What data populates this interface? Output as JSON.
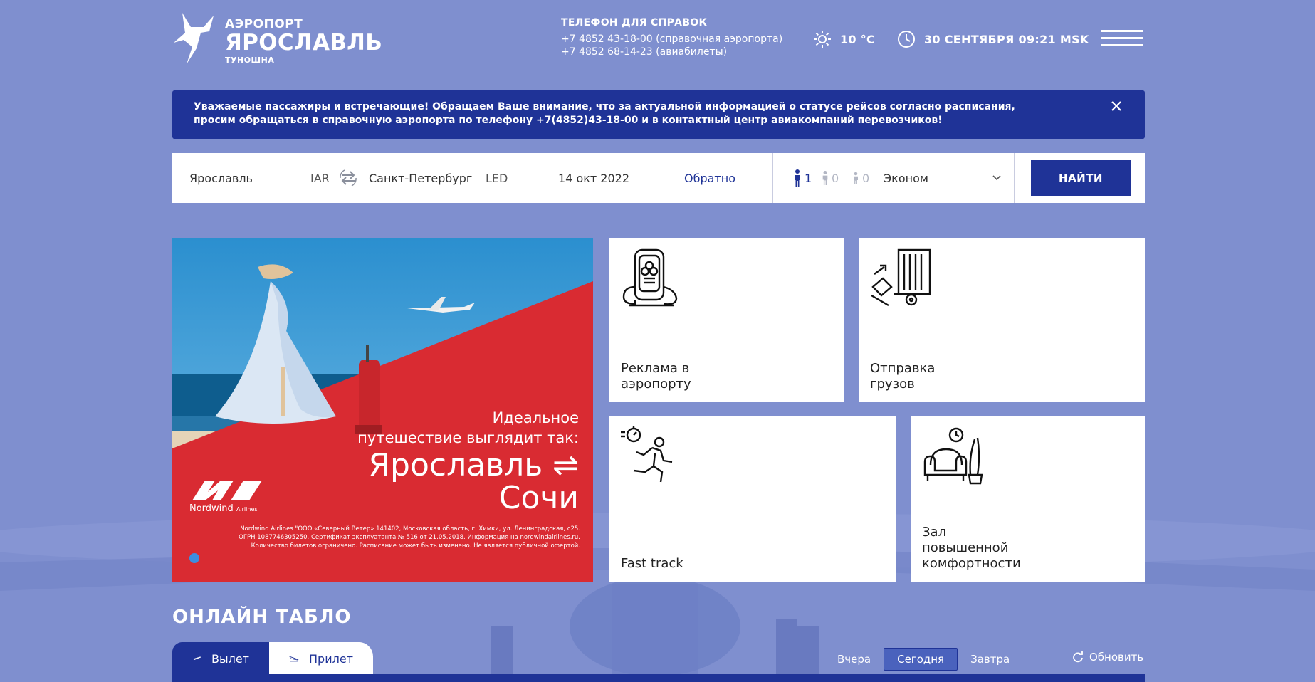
{
  "header": {
    "logo_small": "АЭРОПОРТ",
    "logo_big": "ЯРОСЛАВЛЬ",
    "logo_sub": "ТУНОШНА",
    "phones_title": "ТЕЛЕФОН ДЛЯ СПРАВОК",
    "phone_airport": "+7 4852 43-18-00 (справочная аэропорта)",
    "phone_tickets": "+7 4852 68-14-23 (авиабилеты)",
    "temperature": "10 °C",
    "datetime": "30 СЕНТЯБРЯ 09:21 MSK",
    "icons": [
      "sun-icon",
      "clock-icon",
      "hamburger-menu-icon"
    ]
  },
  "notice": {
    "line1": "Уважаемые пассажиры и встречающие! Обращаем Ваше внимание, что за актуальной информацией о статусе рейсов согласно расписания,",
    "line2": "просим обращаться в справочную аэропорта по телефону +7(4852)43-18-00 и в контактный центр авиакомпаний перевозчиков!"
  },
  "search": {
    "from_city": "Ярославль",
    "from_code": "IAR",
    "to_city": "Санкт-Петербург",
    "to_code": "LED",
    "date": "14 окт 2022",
    "return_label": "Обратно",
    "adults": "1",
    "children": "0",
    "infants": "0",
    "class": "Эконом",
    "find_label": "НАЙТИ"
  },
  "banner": {
    "tagline1": "Идеальное",
    "tagline2": "путешествие выглядит так:",
    "route_from": "Ярославль ⇌",
    "route_to": "Сочи",
    "airline": "Nordwind",
    "airline_suffix": "Airlines",
    "legal1": "Nordwind Airlines \"ООО «Северный Ветер» 141402, Московская область, г. Химки, ул. Ленинградская, с25.",
    "legal2": "ОГРН 1087746305250. Сертификат эксплуатанта № 516 от 21.05.2018. Информация на nordwindairlines.ru.",
    "legal3": "Количество билетов ограничено. Расписание может быть изменено. Не является публичной офертой."
  },
  "tiles": {
    "ads": "Реклама в аэропорту",
    "cargo": "Отправка грузов",
    "fasttrack": "Fast track",
    "lounge": "Зал повышенной комфортности"
  },
  "board": {
    "title": "ОНЛАЙН ТАБЛО",
    "tab_departure": "Вылет",
    "tab_arrival": "Прилет",
    "yesterday": "Вчера",
    "today": "Сегодня",
    "tomorrow": "Завтра",
    "refresh": "Обновить"
  },
  "colors": {
    "background": "#7f8fcf",
    "accent": "#1f3397",
    "banner_red": "#d92b32"
  }
}
